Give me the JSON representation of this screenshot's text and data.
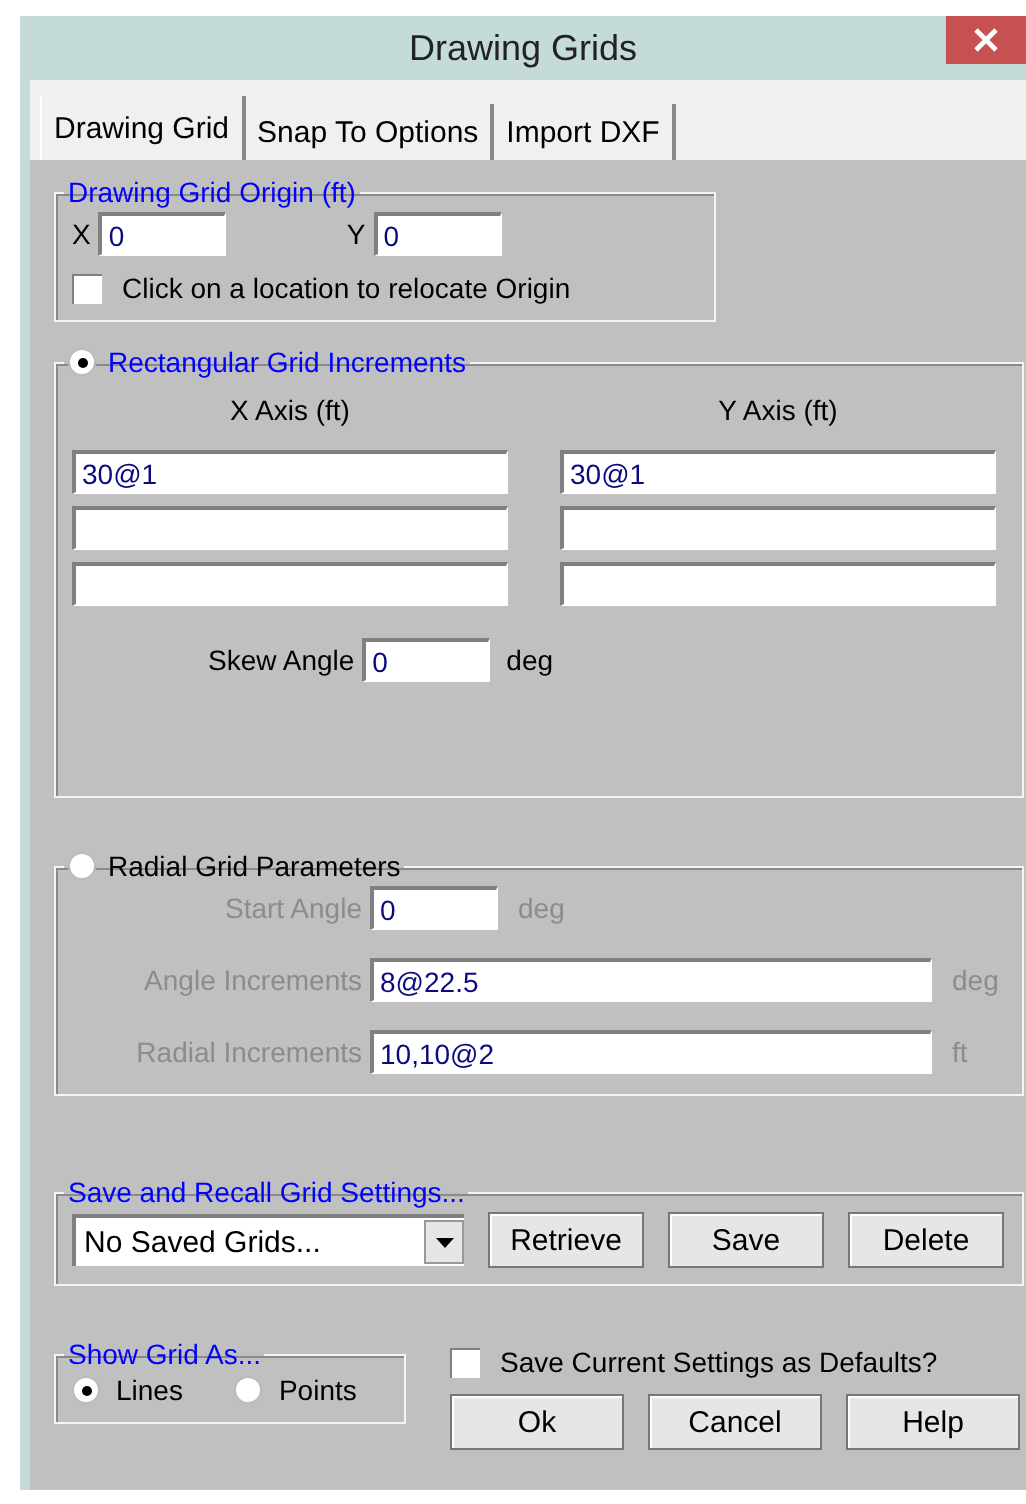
{
  "window": {
    "title": "Drawing Grids"
  },
  "tabs": [
    {
      "label": "Drawing Grid",
      "selected": true
    },
    {
      "label": "Snap To Options",
      "selected": false
    },
    {
      "label": "Import DXF",
      "selected": false
    }
  ],
  "origin": {
    "title": "Drawing Grid Origin (ft)",
    "fields": [
      {
        "label": "X",
        "value": "0"
      },
      {
        "label": "Y",
        "value": "0"
      }
    ],
    "checkbox": {
      "label": "Click on a location to relocate Origin",
      "checked": false
    }
  },
  "rectangular": {
    "label": "Rectangular Grid Increments",
    "selected": true,
    "x_axis_label": "X Axis (ft)",
    "y_axis_label": "Y Axis (ft)",
    "rows": [
      {
        "kind": "filled",
        "x_value": "30@1",
        "y_value": "30@1"
      },
      {
        "kind": "blank"
      },
      {
        "kind": "blank"
      }
    ],
    "skew": {
      "label": "Skew Angle",
      "value": "0",
      "unit": "deg"
    }
  },
  "radial": {
    "label": "Radial Grid Parameters",
    "selected": false,
    "params": [
      {
        "label": "Start Angle",
        "value": "0",
        "unit": "deg",
        "kind": "short"
      },
      {
        "label": "Angle Increments",
        "value": "8@22.5",
        "unit": "deg",
        "kind": "long"
      },
      {
        "label": "Radial Increments",
        "value": "10,10@2",
        "unit": "ft",
        "kind": "long"
      }
    ]
  },
  "saved": {
    "title": "Save and Recall Grid Settings...",
    "dropdown": {
      "value": "No Saved Grids..."
    },
    "buttons": [
      "Retrieve",
      "Save",
      "Delete"
    ]
  },
  "show_grid": {
    "title": "Show Grid As...",
    "options": [
      {
        "label": "Lines",
        "selected": true
      },
      {
        "label": "Points",
        "selected": false
      }
    ]
  },
  "defaults_checkbox": {
    "label": "Save Current Settings as Defaults?",
    "checked": false
  },
  "buttons": [
    "Ok",
    "Cancel",
    "Help"
  ]
}
